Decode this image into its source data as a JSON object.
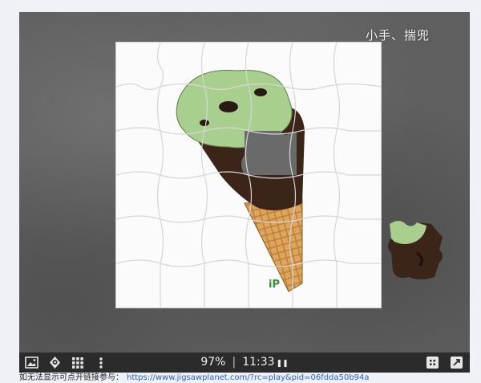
{
  "board": {
    "title": "小手、揣兜",
    "watermark": "iP"
  },
  "toolbar": {
    "icons": [
      "image-icon",
      "ghost-icon",
      "grid-icon",
      "more-icon",
      "edge-pieces-icon",
      "fullscreen-icon"
    ],
    "progress": "97%",
    "timer": "11:33",
    "pause_glyph": "❚❚"
  },
  "footer": {
    "text": "如无法显示可点开链接参与：",
    "link": "https://www.jigsawplanet.com/?rc=play&pid=06fdda50b94a"
  },
  "colors": {
    "board_bg": "#5f5f5f",
    "toolbar_bg": "#2b2b2b",
    "link": "#2a62c9",
    "mint": "#a9cf8e",
    "chocolate": "#3b2418",
    "cone": "#d9a45a"
  }
}
